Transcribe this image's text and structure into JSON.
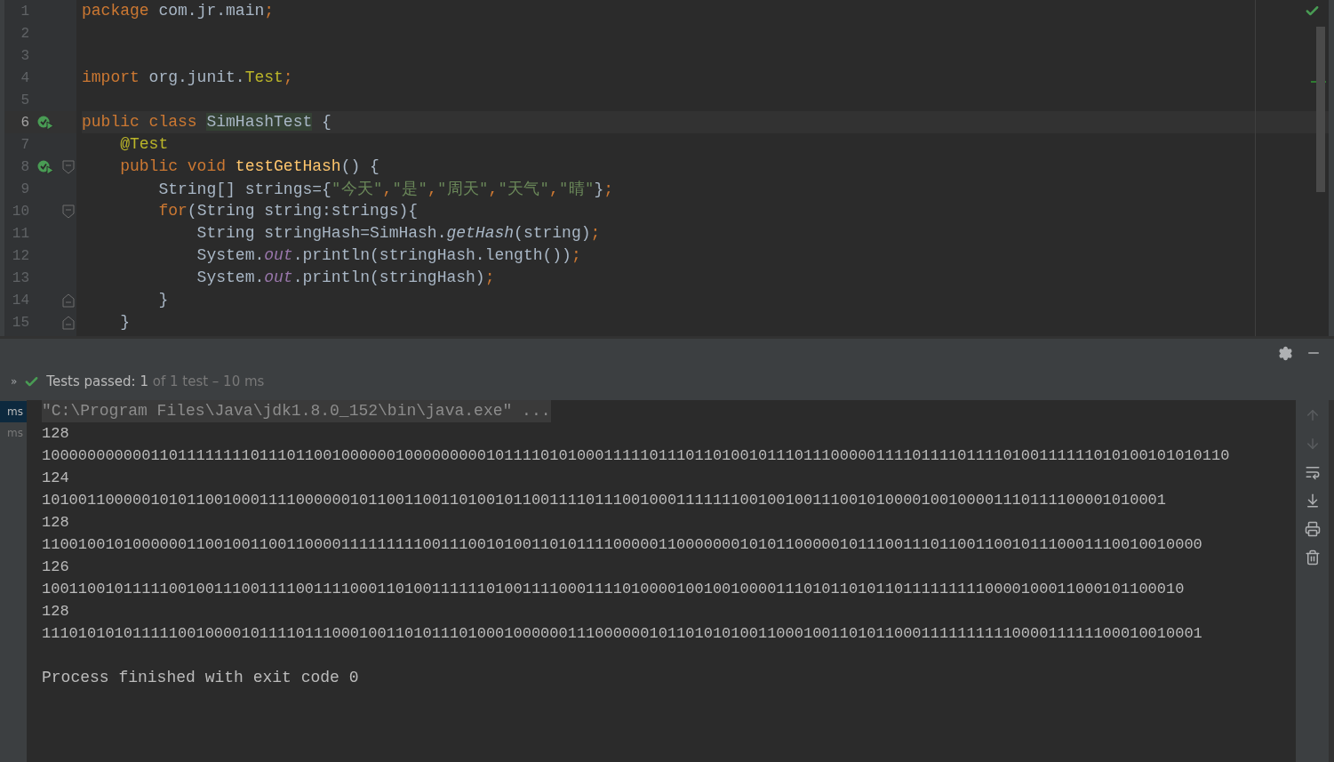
{
  "editor": {
    "lines": [
      {
        "number": "1",
        "kind": "plain",
        "current": false,
        "run_marker": false,
        "tokens": [
          {
            "text": "package",
            "kind": "keyword"
          },
          {
            "text": " com.jr.main",
            "kind": "plain"
          },
          {
            "text": ";",
            "kind": "keyword"
          }
        ]
      },
      {
        "number": "2",
        "kind": "plain",
        "current": false,
        "run_marker": false
      },
      {
        "number": "3",
        "kind": "plain",
        "current": false,
        "run_marker": false
      },
      {
        "number": "4",
        "kind": "plain",
        "current": false,
        "run_marker": false,
        "tokens": [
          {
            "text": "import",
            "kind": "keyword"
          },
          {
            "text": " org.junit.",
            "kind": "plain"
          },
          {
            "text": "Test",
            "kind": "annotation"
          },
          {
            "text": ";",
            "kind": "keyword"
          }
        ]
      },
      {
        "number": "5",
        "kind": "plain",
        "current": false,
        "run_marker": false
      },
      {
        "number": "6",
        "kind": "plain",
        "current": true,
        "run_marker": true,
        "tokens": [
          {
            "text": "public class ",
            "kind": "keyword"
          },
          {
            "text": "SimHashTest",
            "kind": "highlight"
          },
          {
            "text": " {",
            "kind": "plain"
          }
        ]
      },
      {
        "number": "7",
        "kind": "plain",
        "current": false,
        "run_marker": false,
        "tokens": [
          {
            "text": "    @Test",
            "kind": "annotation"
          }
        ]
      },
      {
        "number": "8",
        "kind": "fold_open",
        "current": false,
        "run_marker": true,
        "tokens": [
          {
            "text": "    public void ",
            "kind": "keyword"
          },
          {
            "text": "testGetHash",
            "kind": "method"
          },
          {
            "text": "() {",
            "kind": "plain"
          }
        ]
      },
      {
        "number": "9",
        "kind": "plain",
        "current": false,
        "run_marker": false,
        "tokens": [
          {
            "text": "        String[] strings={",
            "kind": "plain"
          },
          {
            "text": "\"今天\"",
            "kind": "string"
          },
          {
            "text": ",",
            "kind": "keyword"
          },
          {
            "text": "\"是\"",
            "kind": "string"
          },
          {
            "text": ",",
            "kind": "keyword"
          },
          {
            "text": "\"周天\"",
            "kind": "string"
          },
          {
            "text": ",",
            "kind": "keyword"
          },
          {
            "text": "\"天气\"",
            "kind": "string"
          },
          {
            "text": ",",
            "kind": "keyword"
          },
          {
            "text": "\"晴\"",
            "kind": "string"
          },
          {
            "text": "}",
            "kind": "plain"
          },
          {
            "text": ";",
            "kind": "keyword"
          }
        ]
      },
      {
        "number": "10",
        "kind": "fold_open",
        "current": false,
        "run_marker": false,
        "tokens": [
          {
            "text": "        for",
            "kind": "keyword"
          },
          {
            "text": "(String string:strings){",
            "kind": "plain"
          }
        ]
      },
      {
        "number": "11",
        "kind": "plain",
        "current": false,
        "run_marker": false,
        "tokens": [
          {
            "text": "            String stringHash=SimHash.",
            "kind": "plain"
          },
          {
            "text": "getHash",
            "kind": "static"
          },
          {
            "text": "(string)",
            "kind": "plain"
          },
          {
            "text": ";",
            "kind": "keyword"
          }
        ]
      },
      {
        "number": "12",
        "kind": "plain",
        "current": false,
        "run_marker": false,
        "tokens": [
          {
            "text": "            System.",
            "kind": "plain"
          },
          {
            "text": "out",
            "kind": "field"
          },
          {
            "text": ".println(stringHash.length())",
            "kind": "plain"
          },
          {
            "text": ";",
            "kind": "keyword"
          }
        ]
      },
      {
        "number": "13",
        "kind": "plain",
        "current": false,
        "run_marker": false,
        "tokens": [
          {
            "text": "            System.",
            "kind": "plain"
          },
          {
            "text": "out",
            "kind": "field"
          },
          {
            "text": ".println(stringHash)",
            "kind": "plain"
          },
          {
            "text": ";",
            "kind": "keyword"
          }
        ]
      },
      {
        "number": "14",
        "kind": "fold_close",
        "current": false,
        "run_marker": false,
        "tokens": [
          {
            "text": "        }",
            "kind": "plain"
          }
        ]
      },
      {
        "number": "15",
        "kind": "fold_close",
        "current": false,
        "run_marker": false,
        "tokens": [
          {
            "text": "    }",
            "kind": "plain"
          }
        ]
      }
    ]
  },
  "run_panel": {
    "toolbar_toggle": "»",
    "status": {
      "label": "Tests passed:",
      "count": "1",
      "detail": "of 1 test – 10 ms"
    },
    "tree_items": [
      {
        "duration": "ms",
        "selected": true
      },
      {
        "duration": "ms",
        "selected": false
      }
    ],
    "console": [
      {
        "kind": "command",
        "text": "\"C:\\Program Files\\Java\\jdk1.8.0_152\\bin\\java.exe\" ..."
      },
      {
        "kind": "output",
        "text": "128"
      },
      {
        "kind": "output",
        "text": "10000000000011011111111011101100100000010000000001011110101000111110111011010010111011100000111101111011110100111111010100101010110"
      },
      {
        "kind": "output",
        "text": "124"
      },
      {
        "kind": "output",
        "text": "1010011000001010110010001111000000101100110011010010110011110111001000111111100100100111001010000100100001110111100001010001"
      },
      {
        "kind": "output",
        "text": "128"
      },
      {
        "kind": "output",
        "text": "11001001010000001100100110011000011111111100111001010011010111100000110000000101011000001011100111011001100101110001110010010000"
      },
      {
        "kind": "output",
        "text": "126"
      },
      {
        "kind": "output",
        "text": "100110010111110010011100111100111100011010011111101001111000111101000010010010000111010110101101111111110000100011000101100010"
      },
      {
        "kind": "output",
        "text": "128"
      },
      {
        "kind": "output",
        "text": "11101010101111100100001011110111000100110101110100010000001110000001011010101001100010011010110001111111111000011111100010010001"
      },
      {
        "kind": "exit",
        "text": "Process finished with exit code 0"
      }
    ]
  }
}
